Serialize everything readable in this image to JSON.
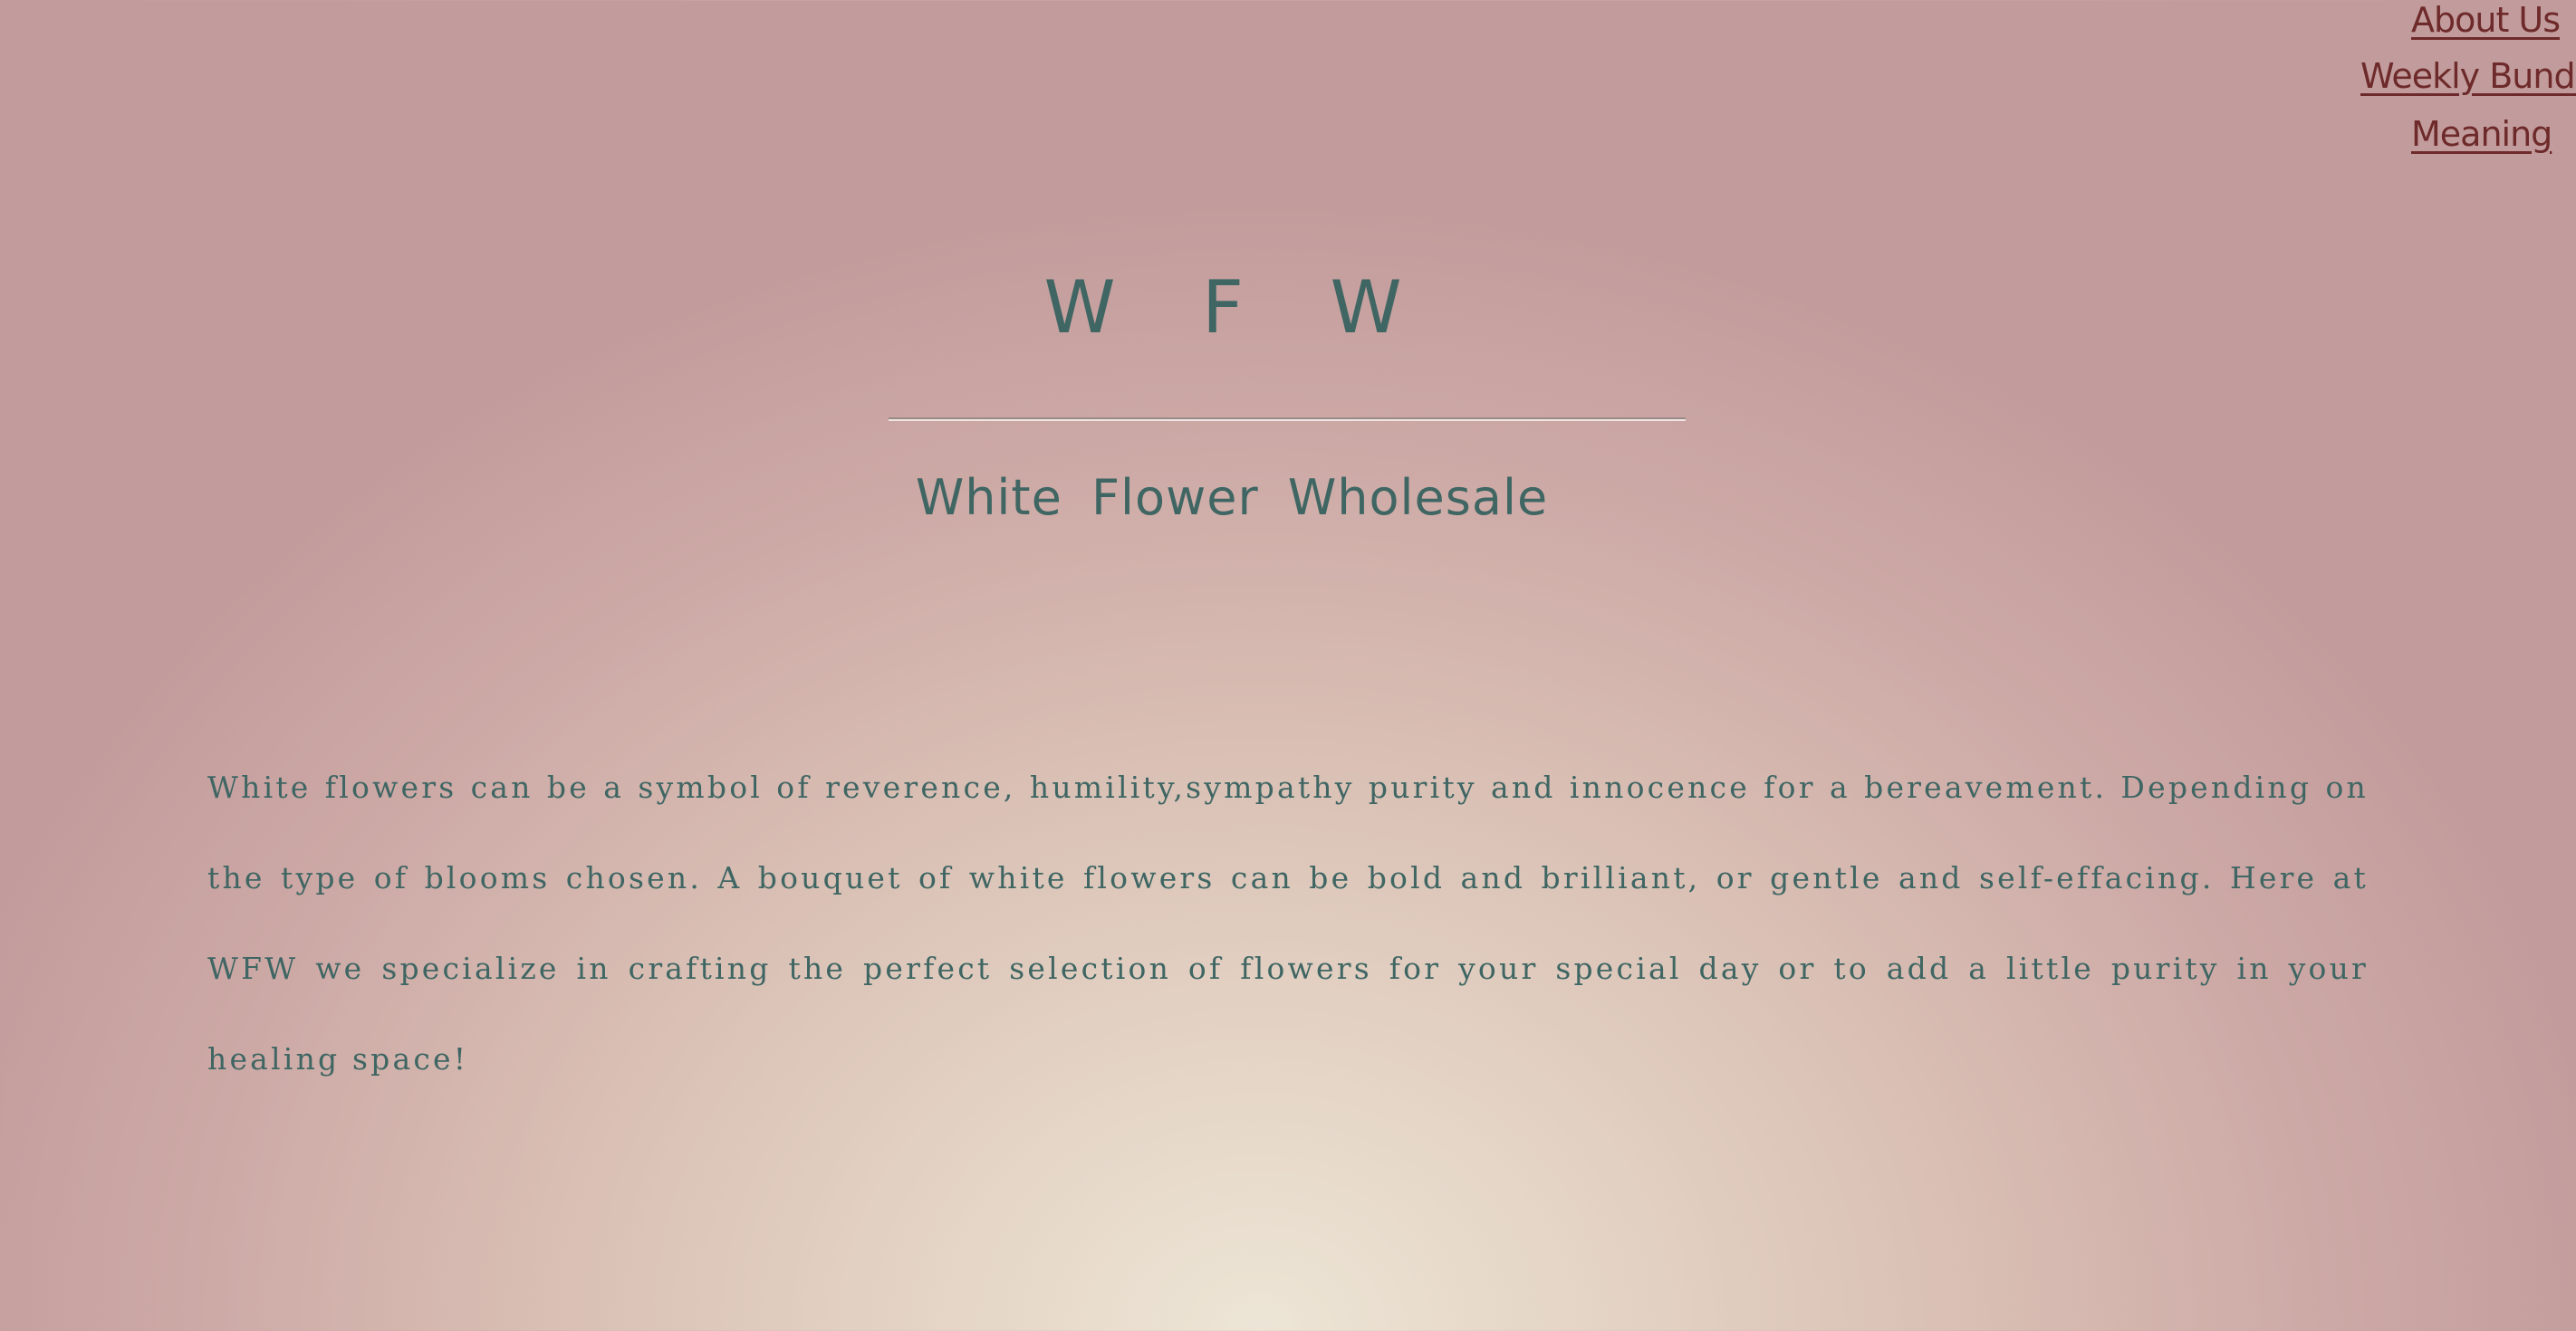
{
  "nav": {
    "items": [
      "About Us",
      "Weekly Bundles",
      "Meaning"
    ]
  },
  "hero": {
    "logo_letters": [
      "W",
      "F",
      "W"
    ],
    "subtitle": "White Flower Wholesale"
  },
  "intro": {
    "text": "White flowers can be a symbol of reverence, humility,sympathy purity and innocence for a bereavement. Depending on the type of blooms chosen. A bouquet of white flowers can be bold and brilliant, or gentle and self-effacing. Here at WFW we specialize in crafting the perfect selection of flowers for your special day or to add a little purity in your healing space!"
  },
  "colors": {
    "text_teal": "#3f6663",
    "link_maroon": "#6e2a2a",
    "bg_center": "#ede5d6",
    "bg_edge": "#c29c9c"
  }
}
